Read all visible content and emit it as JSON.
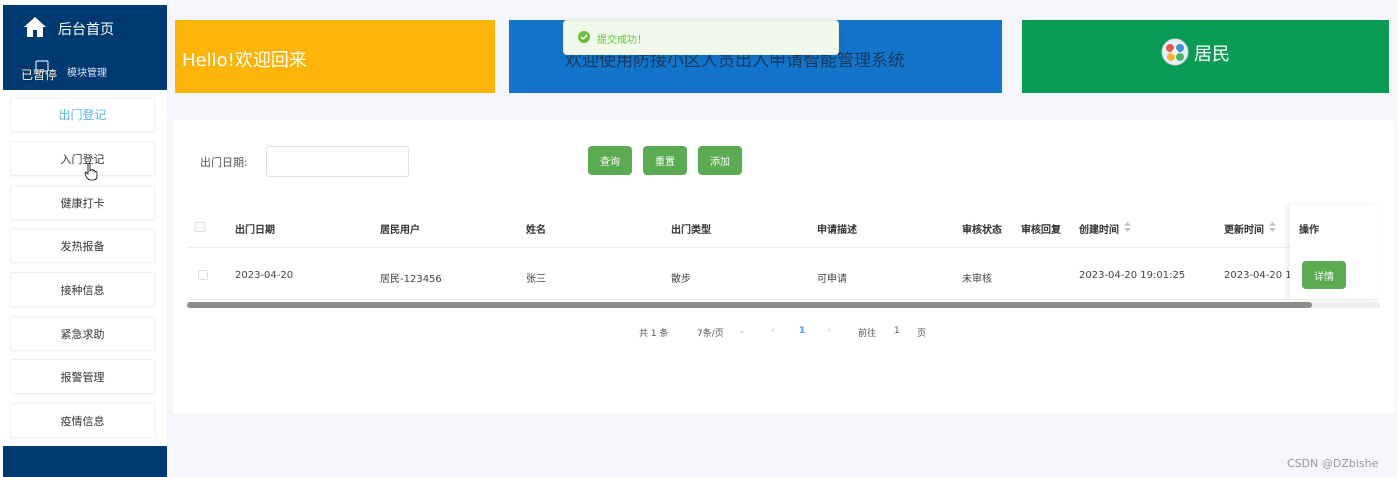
{
  "sidebar": {
    "home_label": "后台首页",
    "module_label": "模块管理",
    "paused_label": "已暂停",
    "items": [
      {
        "label": "出门登记",
        "active": true
      },
      {
        "label": "入门登记",
        "active": false
      },
      {
        "label": "健康打卡",
        "active": false
      },
      {
        "label": "发热报备",
        "active": false
      },
      {
        "label": "接种信息",
        "active": false
      },
      {
        "label": "紧急求助",
        "active": false
      },
      {
        "label": "报警管理",
        "active": false
      },
      {
        "label": "疫情信息",
        "active": false
      }
    ]
  },
  "banners": {
    "hello": "Hello!欢迎回来",
    "welcome": "欢迎使用防接小区人员出入申请智能管理系统",
    "role": "居民"
  },
  "toast": {
    "text": "提交成功！"
  },
  "search": {
    "date_label": "出门日期:",
    "date_value": "",
    "query_button": "查询",
    "reset_button": "重置",
    "add_button": "添加"
  },
  "table": {
    "columns": [
      "出门日期",
      "居民用户",
      "姓名",
      "出门类型",
      "申请描述",
      "审核状态",
      "审核回复",
      "创建时间",
      "更新时间",
      "操作"
    ],
    "rows": [
      {
        "date": "2023-04-20",
        "user": "居民-123456",
        "name": "张三",
        "type": "散步",
        "desc": "可申请",
        "status": "未审核",
        "reply": "",
        "created": "2023-04-20 19:01:25",
        "updated": "2023-04-20 1",
        "action": "详情"
      }
    ]
  },
  "pagination": {
    "total": "共 1 条",
    "page_size": "7条/页",
    "current_page": "1",
    "goto_label": "前往",
    "goto_value": "1",
    "page_suffix": "页"
  },
  "watermark": "CSDN @DZbishe",
  "colors": {
    "sidebar_bg": "#003a70",
    "accent_green": "#5aab52",
    "banner_yellow": "#fdb408",
    "banner_blue": "#1275cb",
    "banner_green": "#0a9c55",
    "active_link": "#5ab4e8"
  }
}
